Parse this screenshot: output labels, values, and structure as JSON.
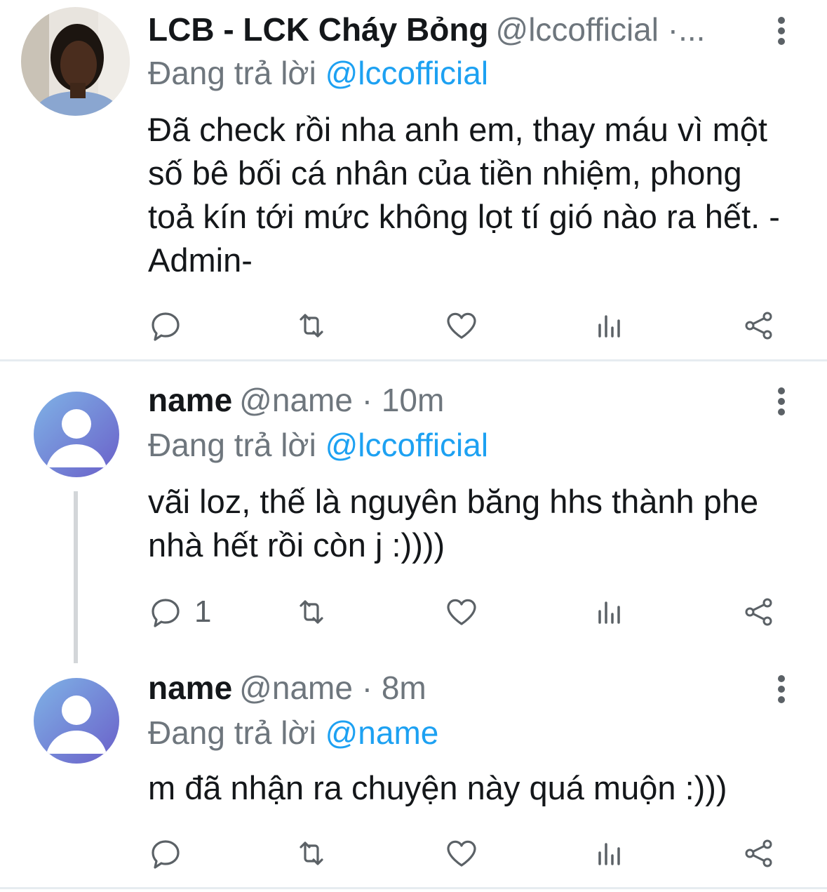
{
  "tweets": [
    {
      "name": "LCB - LCK Cháy Bỏng",
      "handle": "@lccofficial ·...",
      "replying_prefix": "Đang trả lời",
      "replying_to": "@lccofficial",
      "text": "Đã check rồi nha anh em, thay máu vì một số bê bối cá nhân của tiền nhiệm, phong toả kín tới mức không lọt tí gió nào ra hết. -Admin-",
      "reply_count": ""
    },
    {
      "name": "name",
      "handle": "@name · 10m",
      "replying_prefix": "Đang trả lời",
      "replying_to": "@lccofficial",
      "text": "vãi loz, thế là nguyên băng hhs thành phe nhà hết rồi còn j :))))",
      "reply_count": "1"
    },
    {
      "name": "name",
      "handle": "@name · 8m",
      "replying_prefix": "Đang trả lời",
      "replying_to": "@name",
      "text": "m đã nhận ra chuyện này quá muộn :)))",
      "reply_count": ""
    }
  ],
  "icons": {
    "reply": "reply-icon",
    "retweet": "retweet-icon",
    "like": "heart-icon",
    "stats": "analytics-icon",
    "share": "share-icon",
    "more": "more-vertical-icon"
  },
  "colors": {
    "link": "#1da1f2",
    "secondary_text": "#6e767d",
    "default_avatar": "#6f8fd8"
  }
}
